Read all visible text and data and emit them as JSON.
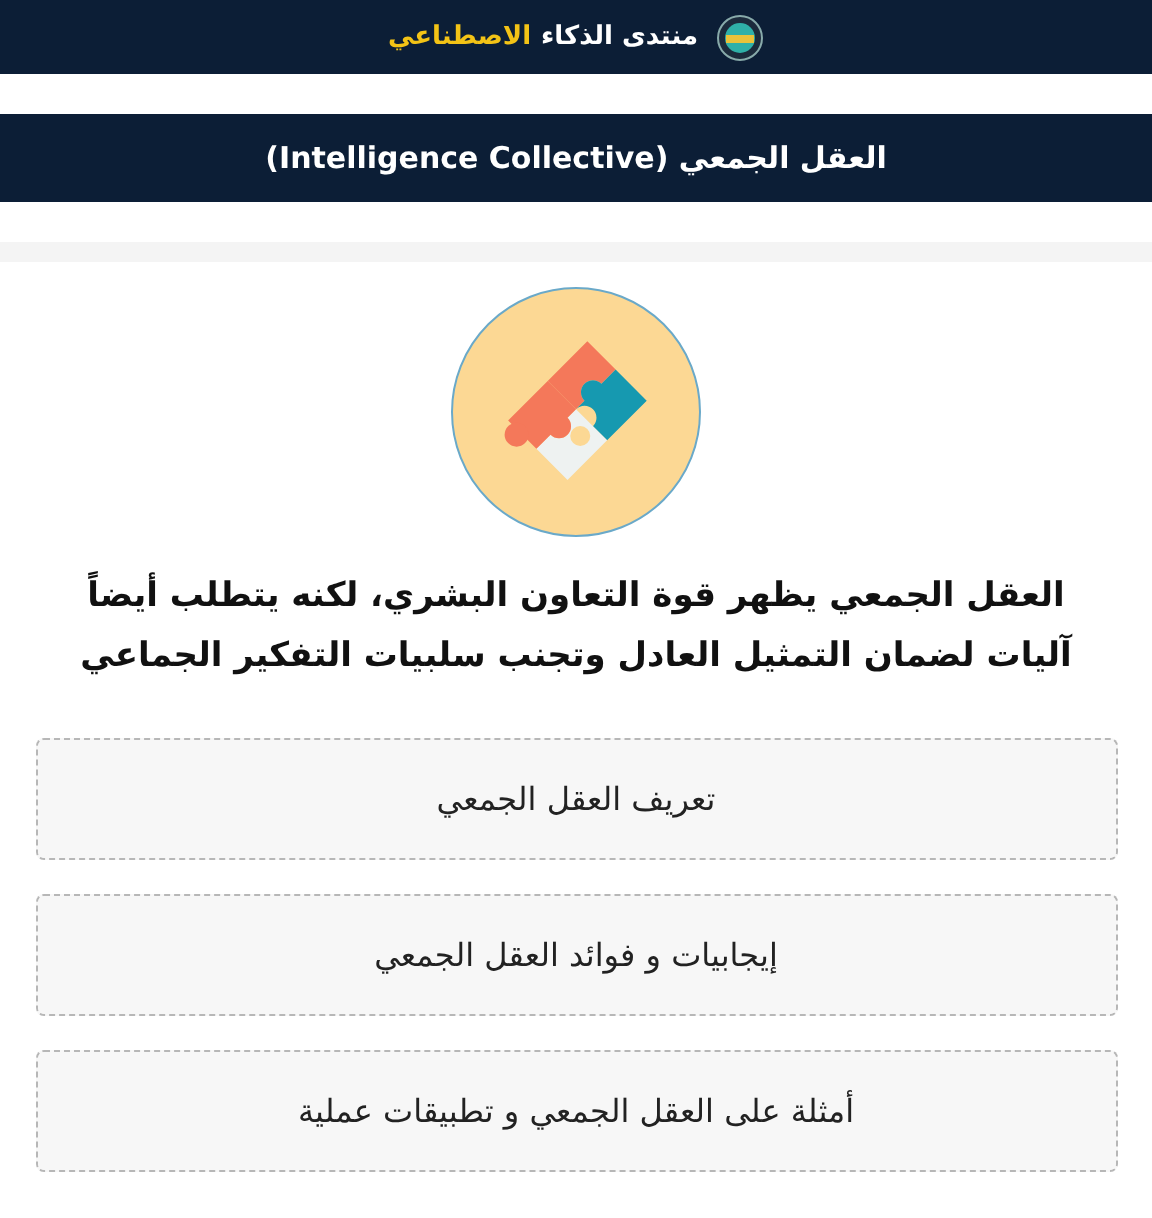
{
  "brand": {
    "name": "منتدى الذكاء",
    "highlight": "الاصطناعي"
  },
  "title_bar": {
    "title": "العقل الجمعي (Intelligence Collective)"
  },
  "card": {
    "summary": "العقل الجمعي يظهر قوة التعاون البشري، لكنه يتطلب أيضاً آليات لضمان التمثيل العادل وتجنب سلبيات التفكير الجماعي",
    "links": [
      {
        "label": "تعريف العقل الجمعي"
      },
      {
        "label": "إيجابيات و فوائد العقل الجمعي"
      },
      {
        "label": "أمثلة على العقل الجمعي و تطبيقات عملية"
      }
    ]
  }
}
